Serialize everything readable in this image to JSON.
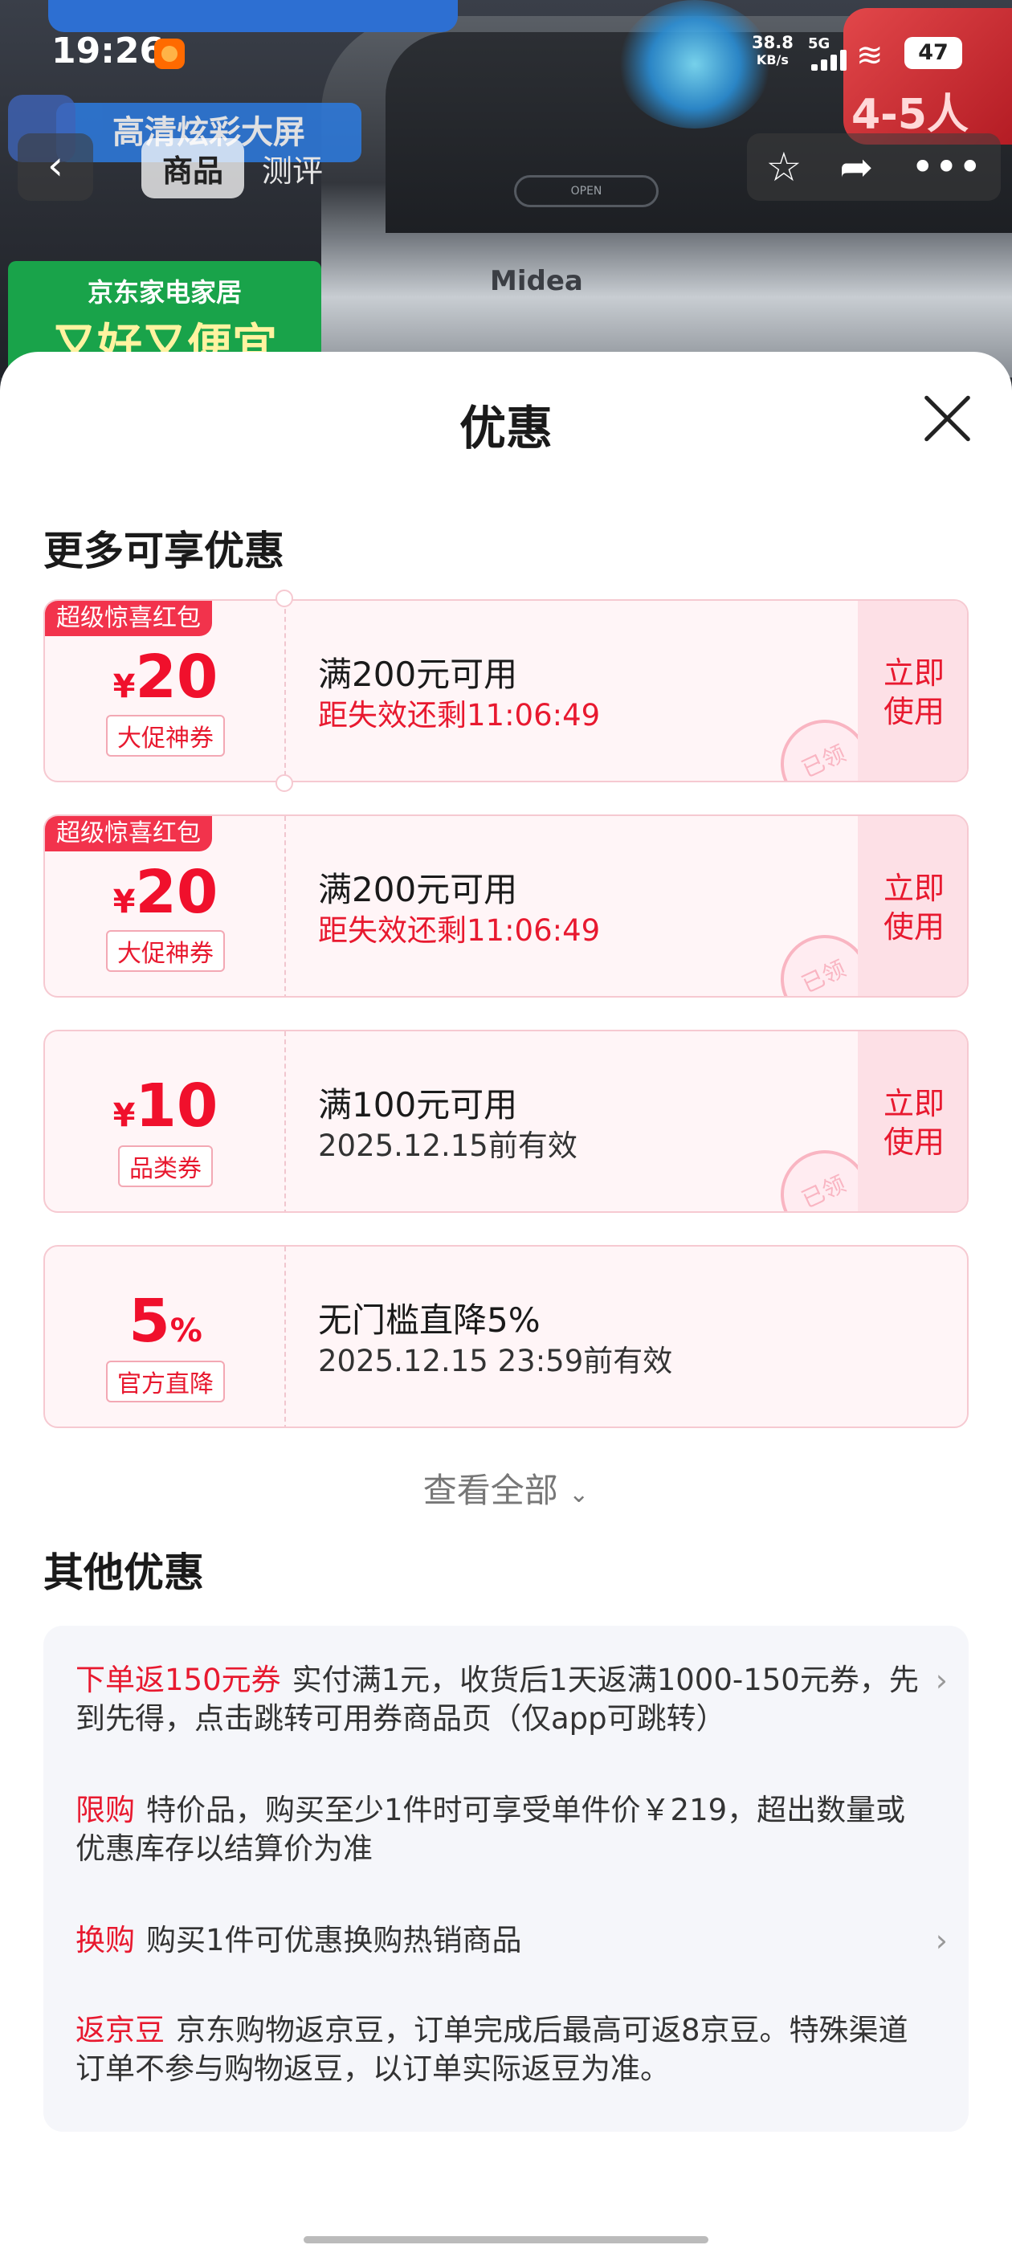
{
  "status_bar": {
    "time": "19:26",
    "net_speed": "38.8",
    "net_unit": "KB/s",
    "network": "5G",
    "battery": "47"
  },
  "background": {
    "promo_blue": "高清炫彩大屏",
    "promo_green_line1": "京东家电家居",
    "promo_green_line2": "又好又便宜",
    "brand": "Midea",
    "lid_text": "OPEN",
    "badge": "4-5人"
  },
  "nav": {
    "back_icon": "chevron-left-icon",
    "tab_product": "商品",
    "tab_review": "测评"
  },
  "sheet": {
    "title": "优惠",
    "section_more": "更多可享优惠",
    "view_all": "查看全部",
    "section_other": "其他优惠"
  },
  "coupons": [
    {
      "tag": "超级惊喜红包",
      "currency": "¥",
      "amount": "20",
      "kind": "大促神券",
      "condition": "满200元可用",
      "sub": "距失效还剩11:06:49",
      "action": "立即\n使用",
      "stamp": "已领"
    },
    {
      "tag": "超级惊喜红包",
      "currency": "¥",
      "amount": "20",
      "kind": "大促神券",
      "condition": "满200元可用",
      "sub": "距失效还剩11:06:49",
      "action": "立即\n使用",
      "stamp": "已领"
    },
    {
      "currency": "¥",
      "amount": "10",
      "kind": "品类券",
      "condition": "满100元可用",
      "sub": "2025.12.15前有效",
      "action": "立即\n使用",
      "stamp": "已领"
    },
    {
      "amount": "5",
      "unit": "%",
      "kind": "官方直降",
      "condition": "无门槛直降5%",
      "sub": "2025.12.15 23:59前有效"
    }
  ],
  "other_offers": [
    {
      "label": "下单返150元券",
      "text": "实付满1元，收货后1天返满1000-150元券，先到先得，点击跳转可用券商品页（仅app可跳转）"
    },
    {
      "label": "限购",
      "text": "特价品，购买至少1件时可享受单件价￥219，超出数量或优惠库存以结算价为准"
    },
    {
      "label": "换购",
      "text": "购买1件可优惠换购热销商品"
    },
    {
      "label": "返京豆",
      "text": "京东购物返京豆，订单完成后最高可返8京豆。特殊渠道订单不参与购物返豆，以订单实际返豆为准。"
    }
  ],
  "colors": {
    "accent_red": "#e8192f",
    "coupon_bg": "#fff5f7",
    "sheet_bg": "#ffffff",
    "other_bg": "#f5f6fa"
  }
}
